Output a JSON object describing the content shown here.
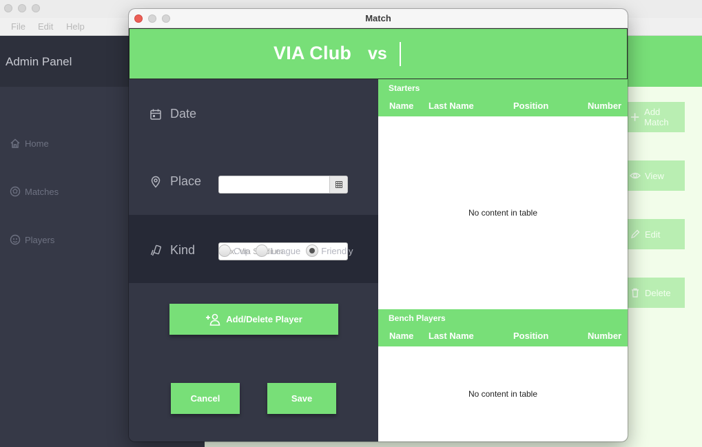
{
  "app": {
    "menu": [
      "File",
      "Edit",
      "Help"
    ],
    "sidebar": {
      "title": "Admin Panel",
      "items": [
        {
          "label": "Home",
          "icon": "home-icon"
        },
        {
          "label": "Matches",
          "icon": "soccer-ball-icon"
        },
        {
          "label": "Players",
          "icon": "player-icon"
        }
      ]
    },
    "actions": [
      {
        "label": "Add Match",
        "icon": "plus-icon"
      },
      {
        "label": "View",
        "icon": "eye-icon"
      },
      {
        "label": "Edit",
        "icon": "pencil-icon"
      },
      {
        "label": "Delete",
        "icon": "trash-icon"
      }
    ]
  },
  "dialog": {
    "window_title": "Match",
    "header": {
      "team": "VIA Club",
      "vs": "vs",
      "opponent": ""
    },
    "form": {
      "date_label": "Date",
      "date_value": "",
      "place_label": "Place",
      "place_value": "",
      "place_placeholder": "Ex. Via Stadium",
      "kind_label": "Kind",
      "kind_options": [
        "Cup",
        "League",
        "Friendly"
      ],
      "kind_selected": "Friendly"
    },
    "buttons": {
      "add_delete_player": "Add/Delete Player",
      "cancel": "Cancel",
      "save": "Save"
    },
    "starters": {
      "title": "Starters",
      "columns": [
        "Name",
        "Last Name",
        "Position",
        "Number"
      ],
      "empty_message": "No content in table"
    },
    "bench": {
      "title": "Bench Players",
      "columns": [
        "Name",
        "Last Name",
        "Position",
        "Number"
      ],
      "empty_message": "No content in table"
    }
  },
  "colors": {
    "accent_green": "#78df78",
    "panel_dark": "#343745",
    "panel_darker": "#262936",
    "close_red": "#ec5f57"
  }
}
